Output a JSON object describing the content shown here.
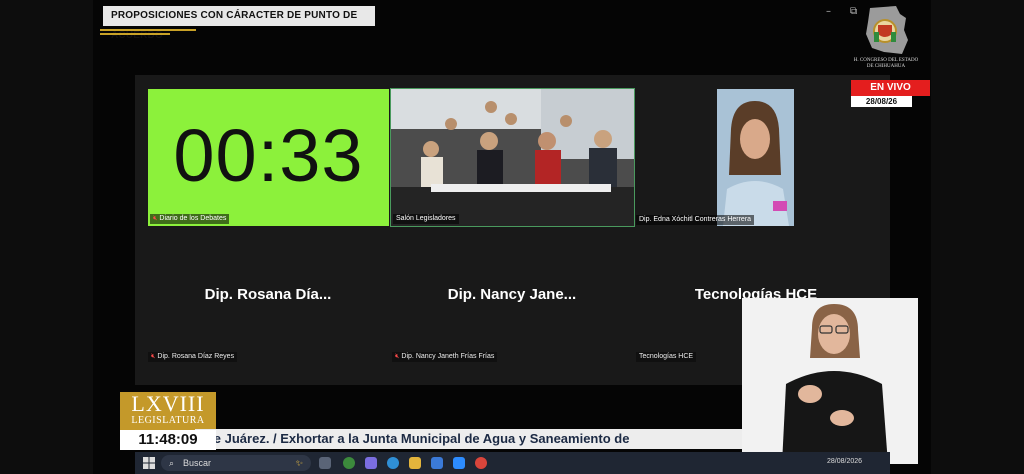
{
  "topic_title": "PROPOSICIONES CON CÁRACTER DE PUNTO DE ACUERDO",
  "window_controls": {
    "minimize": "–",
    "restore": "⧉"
  },
  "branding": {
    "congress_line1": "H. CONGRESO DEL ESTADO",
    "congress_line2": "DE CHIHUAHUA"
  },
  "live": {
    "label": "EN VIVO",
    "date": "28/08/26"
  },
  "tiles": {
    "timer": {
      "value": "00:33",
      "label": "Diario de los Debates"
    },
    "salon": {
      "label": "Salón Legisladores"
    },
    "video": {
      "label": "Dip. Edna Xóchitl Contreras Herrera"
    }
  },
  "participants": [
    {
      "display": "Dip. Rosana Día...",
      "full": "Dip. Rosana Díaz Reyes",
      "muted": true
    },
    {
      "display": "Dip. Nancy Jane...",
      "full": "Dip. Nancy Janeth Frías Frías",
      "muted": true
    },
    {
      "display": "Tecnologías HCE",
      "full": "Tecnologías HCE",
      "muted": false
    }
  ],
  "legislature": {
    "number": "LXVIII",
    "word": "LEGISLATURA"
  },
  "clock": "11:48:09",
  "ticker": "s de Juárez.   /    Exhortar a la Junta Municipal de Agua y Saneamiento de",
  "taskbar": {
    "search_placeholder": "Buscar",
    "date": "28/08/2026"
  },
  "colors": {
    "timer_bg": "#8cf13b",
    "live_red": "#e41e1e",
    "legis_gold": "#c4992a",
    "ticker_text": "#1c2a44"
  }
}
